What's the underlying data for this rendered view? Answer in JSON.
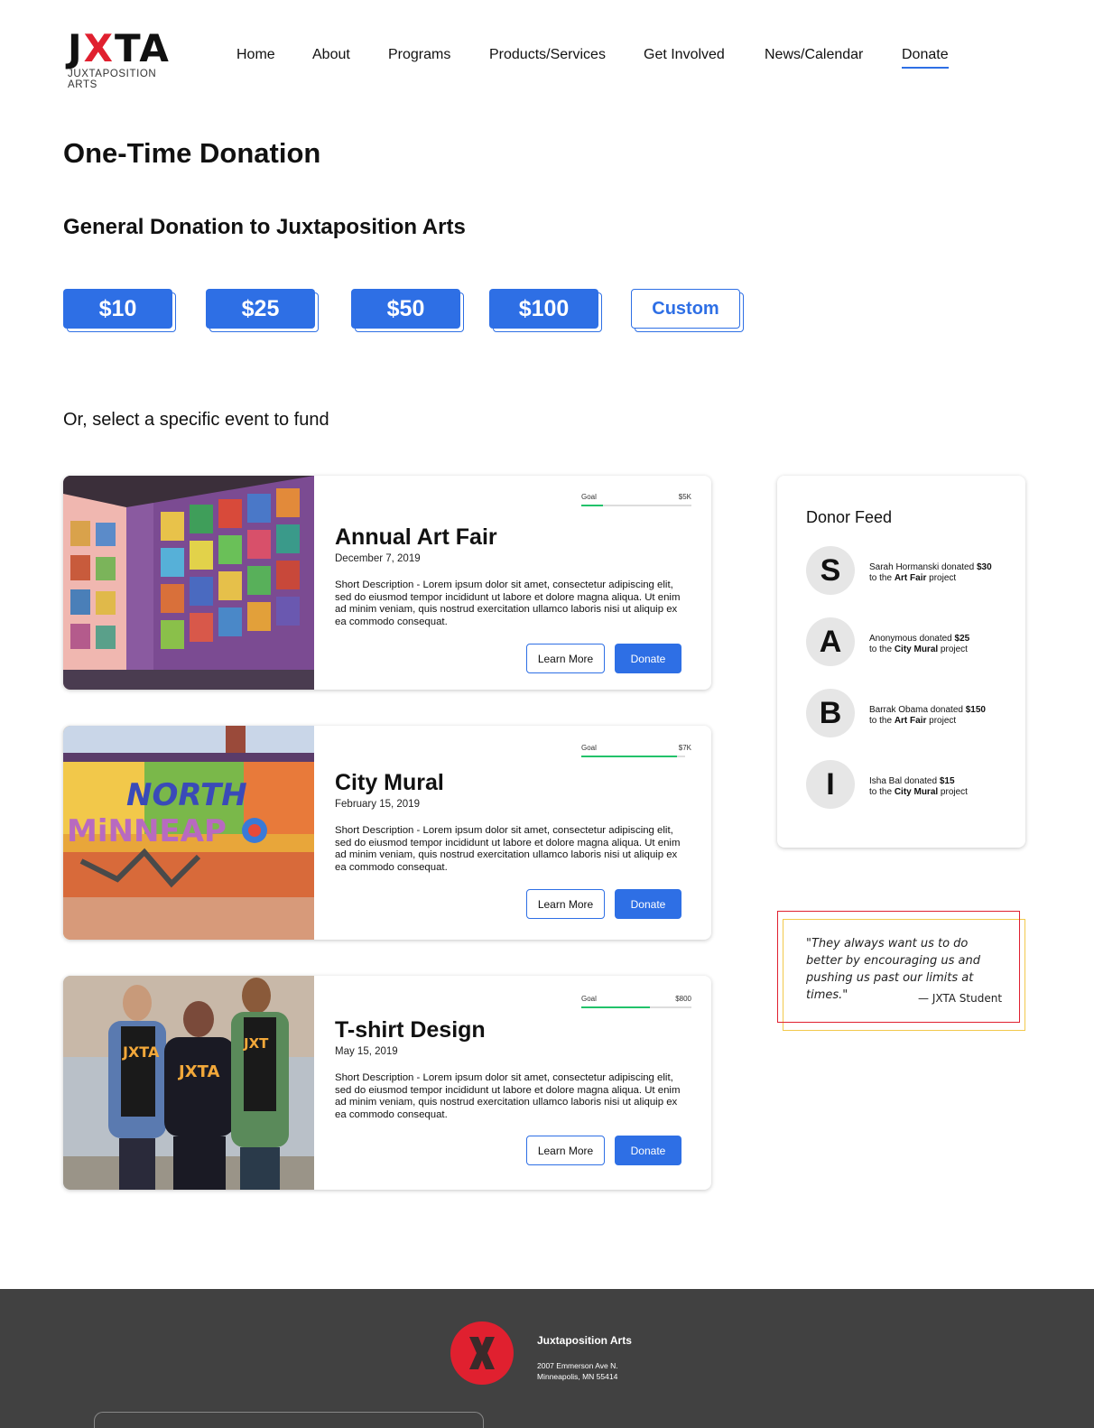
{
  "header": {
    "logo_text": "JXTA",
    "logo_sub": "JUXTAPOSITION ARTS",
    "nav": [
      {
        "label": "Home"
      },
      {
        "label": "About"
      },
      {
        "label": "Programs"
      },
      {
        "label": "Products/Services"
      },
      {
        "label": "Get Involved"
      },
      {
        "label": "News/Calendar"
      },
      {
        "label": "Donate",
        "active": true
      }
    ]
  },
  "page": {
    "title": "One-Time Donation",
    "general_heading": "General Donation to Juxtaposition Arts",
    "amounts": [
      "$10",
      "$25",
      "$50",
      "$100",
      "Custom"
    ],
    "or_text": "Or, select a specific event to fund"
  },
  "events": [
    {
      "title": "Annual Art Fair",
      "date": "December 7, 2019",
      "description": "Short Description - Lorem ipsum dolor sit amet, consectetur adipiscing elit, sed do eiusmod tempor incididunt ut labore et dolore magna aliqua. Ut enim ad minim veniam, quis nostrud exercitation ullamco laboris nisi ut aliquip ex ea commodo consequat.",
      "goal_label": "Goal",
      "goal_amount": "$5K",
      "progress": 0.2,
      "learn_label": "Learn More",
      "donate_label": "Donate"
    },
    {
      "title": "City Mural",
      "date": "February 15, 2019",
      "description": "Short Description - Lorem ipsum dolor sit amet, consectetur adipiscing elit, sed do eiusmod tempor incididunt ut labore et dolore magna aliqua. Ut enim ad minim veniam, quis nostrud exercitation ullamco laboris nisi ut aliquip ex ea commodo consequat.",
      "goal_label": "Goal",
      "goal_amount": "$7K",
      "progress": 0.92,
      "learn_label": "Learn More",
      "donate_label": "Donate"
    },
    {
      "title": "T-shirt Design",
      "date": "May 15, 2019",
      "description": "Short Description - Lorem ipsum dolor sit amet, consectetur adipiscing elit, sed do eiusmod tempor incididunt ut labore et dolore magna aliqua. Ut enim ad minim veniam, quis nostrud exercitation ullamco laboris nisi ut aliquip ex ea commodo consequat.",
      "goal_label": "Goal",
      "goal_amount": "$800",
      "progress": 0.62,
      "learn_label": "Learn More",
      "donate_label": "Donate"
    }
  ],
  "feed": {
    "title": "Donor Feed",
    "donors": [
      {
        "initial": "S",
        "name_text": "Sarah Hormanski donated ",
        "amount": "$30",
        "to_text": "to the ",
        "project": "Art Fair",
        "suffix": " project"
      },
      {
        "initial": "A",
        "name_text": "Anonymous donated ",
        "amount": "$25",
        "to_text": "to the ",
        "project": "City Mural",
        "suffix": " project"
      },
      {
        "initial": "B",
        "name_text": "Barrak Obama donated ",
        "amount": "$150",
        "to_text": "to the ",
        "project": "Art Fair",
        "suffix": " project"
      },
      {
        "initial": "I",
        "name_text": "Isha Bal donated ",
        "amount": "$15",
        "to_text": "to the ",
        "project": "City Mural",
        "suffix": " project"
      }
    ]
  },
  "quote": {
    "text": "\"They always want us to do better by encouraging us and pushing us past our limits at times.\"",
    "author": "— JXTA Student"
  },
  "footer": {
    "logo_letter": "X",
    "org": "Juxtaposition Arts",
    "address_line1": "2007 Emmerson Ave N.",
    "address_line2": "Minneapolis, MN 55414"
  },
  "colors": {
    "accent": "#2e6fe5",
    "brand_red": "#e0202f",
    "progress_green": "#22c26a",
    "footer_bg": "#414141"
  }
}
